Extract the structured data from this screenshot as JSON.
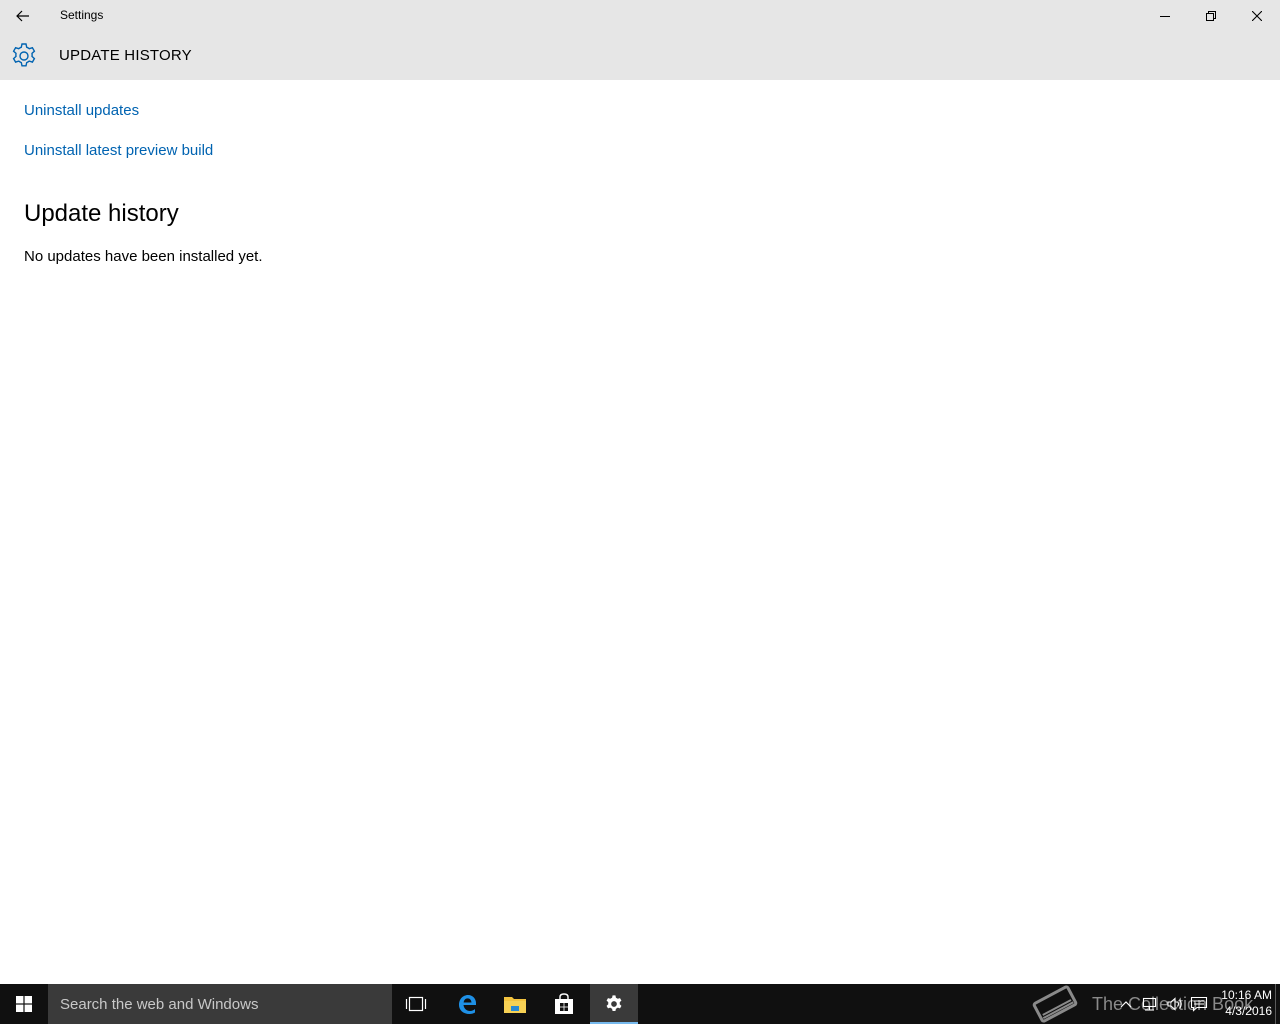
{
  "window": {
    "app_title": "Settings",
    "page_header": "UPDATE HISTORY",
    "accent_color": "#0063b1",
    "controls": [
      "minimize",
      "restore",
      "close"
    ]
  },
  "links": {
    "uninstall_updates": "Uninstall updates",
    "uninstall_preview_build": "Uninstall latest preview build"
  },
  "history": {
    "title": "Update history",
    "empty_message": "No updates have been installed yet."
  },
  "taskbar": {
    "search_placeholder": "Search the web and Windows",
    "pinned_apps": [
      "task-view",
      "edge",
      "file-explorer",
      "store",
      "settings"
    ],
    "active_app": "settings",
    "watermark": "The Collection Book",
    "clock": {
      "time": "10:16 AM",
      "date": "4/3/2016"
    }
  }
}
